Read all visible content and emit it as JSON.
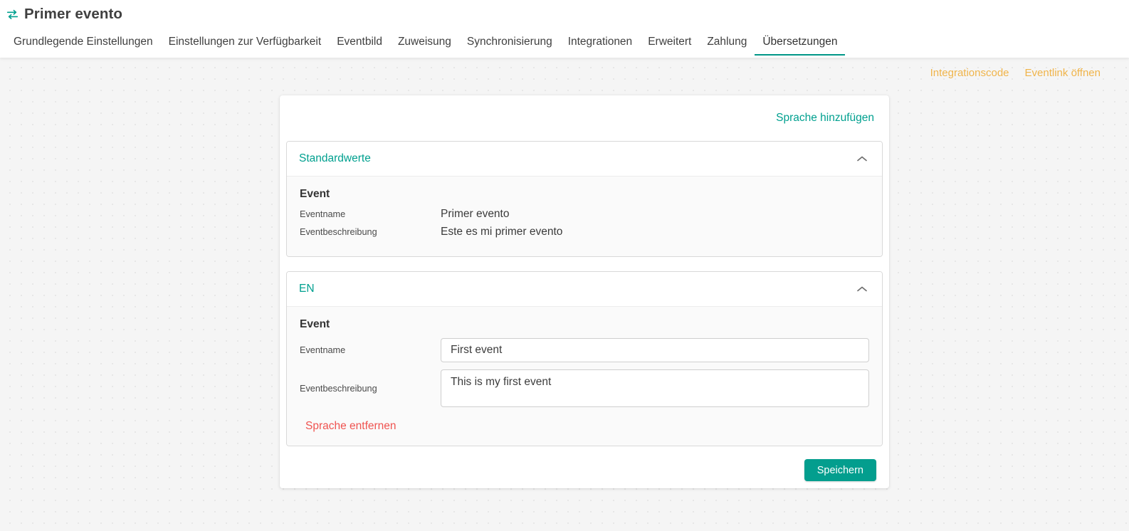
{
  "header": {
    "icon": "exchange-arrows-icon",
    "title": "Primer evento",
    "tabs": [
      {
        "label": "Grundlegende Einstellungen",
        "active": false
      },
      {
        "label": "Einstellungen zur Verfügbarkeit",
        "active": false
      },
      {
        "label": "Eventbild",
        "active": false
      },
      {
        "label": "Zuweisung",
        "active": false
      },
      {
        "label": "Synchronisierung",
        "active": false
      },
      {
        "label": "Integrationen",
        "active": false
      },
      {
        "label": "Erweitert",
        "active": false
      },
      {
        "label": "Zahlung",
        "active": false
      },
      {
        "label": "Übersetzungen",
        "active": true
      }
    ]
  },
  "utility_links": [
    {
      "label": "Integrationscode"
    },
    {
      "label": "Eventlink öffnen"
    }
  ],
  "card": {
    "add_language_label": "Sprache hinzufügen",
    "panels": [
      {
        "id": "default-values",
        "title": "Standardwerte",
        "collapse_icon": "chevron-up-icon",
        "section_title": "Event",
        "type": "readonly",
        "rows": [
          {
            "label": "Eventname",
            "value": "Primer evento"
          },
          {
            "label": "Eventbeschreibung",
            "value": "Este es mi primer evento"
          }
        ]
      },
      {
        "id": "en",
        "title": "EN",
        "collapse_icon": "chevron-up-icon",
        "section_title": "Event",
        "type": "editable",
        "rows": [
          {
            "label": "Eventname",
            "value": "First event",
            "placeholder": "",
            "control": "input"
          },
          {
            "label": "Eventbeschreibung",
            "value": "This is my first event",
            "placeholder": "",
            "control": "textarea"
          }
        ],
        "remove_language_label": "Sprache entfernen"
      }
    ],
    "save_label": "Speichern"
  },
  "colors": {
    "accent_teal": "#009688",
    "link_teal": "#00a08f",
    "link_orange": "#f0b44a",
    "link_red": "#ef5350",
    "button_teal": "#039e8e"
  }
}
